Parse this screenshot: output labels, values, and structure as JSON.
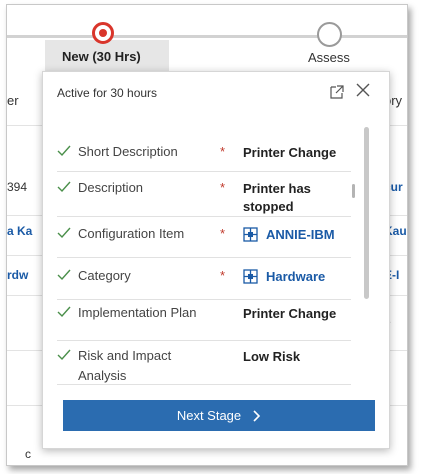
{
  "process": {
    "stages": [
      {
        "label": "New  (30 Hrs)",
        "status": "active"
      },
      {
        "label": "Assess",
        "status": "upcoming"
      }
    ],
    "active_color": "#d9352b"
  },
  "background": {
    "row1_left": "er",
    "row1_right": "ory",
    "row2_left": "394",
    "row2_right": "cur",
    "row3_left": "a Ka",
    "row3_right": "Kau",
    "row4_left": "rdw",
    "row4_right": "E-I",
    "row5_right": "e",
    "bottom_left": "c"
  },
  "flyout": {
    "title": "Active for 30 hours",
    "fields": [
      {
        "label": "Short Description",
        "required": "*",
        "value": "Printer Change"
      },
      {
        "label": "Description",
        "required": "*",
        "value": "Printer has stopped"
      },
      {
        "label": "Configuration Item",
        "required": "*",
        "value": "ANNIE-IBM",
        "icon": "lookup-icon"
      },
      {
        "label": "Category",
        "required": "*",
        "value": "Hardware",
        "icon": "lookup-icon"
      },
      {
        "label": "Implementation Plan",
        "required": "",
        "value": "Printer Change"
      },
      {
        "label": "Risk and Impact Analysis",
        "required": "",
        "value": "Low Risk"
      }
    ],
    "next_stage_label": "Next Stage",
    "check_color": "#4a8f4a",
    "accent": "#2b6cb0"
  }
}
